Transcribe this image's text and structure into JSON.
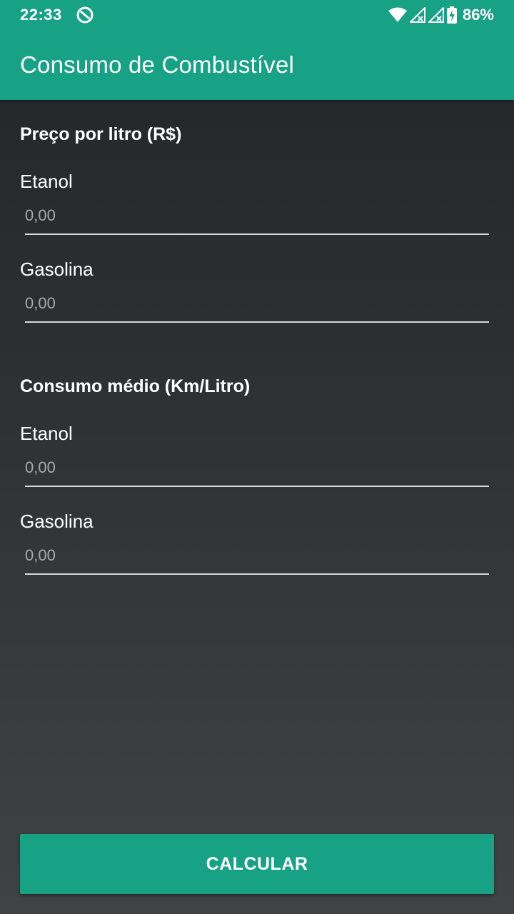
{
  "status_bar": {
    "time": "22:33",
    "battery": "86%",
    "icons": [
      "notification-icon",
      "wifi-icon",
      "signal-icon",
      "signal-icon",
      "battery-charging-icon"
    ]
  },
  "app_bar": {
    "title": "Consumo de Combustível",
    "color": "#17a185"
  },
  "price_section": {
    "title": "Preço por litro (R$)",
    "ethanol_label": "Etanol",
    "ethanol_placeholder": "0,00",
    "gasoline_label": "Gasolina",
    "gasoline_placeholder": "0,00"
  },
  "consumption_section": {
    "title": "Consumo médio (Km/Litro)",
    "ethanol_label": "Etanol",
    "ethanol_placeholder": "0,00",
    "gasoline_label": "Gasolina",
    "gasoline_placeholder": "0,00"
  },
  "actions": {
    "calculate_label": "CALCULAR"
  }
}
